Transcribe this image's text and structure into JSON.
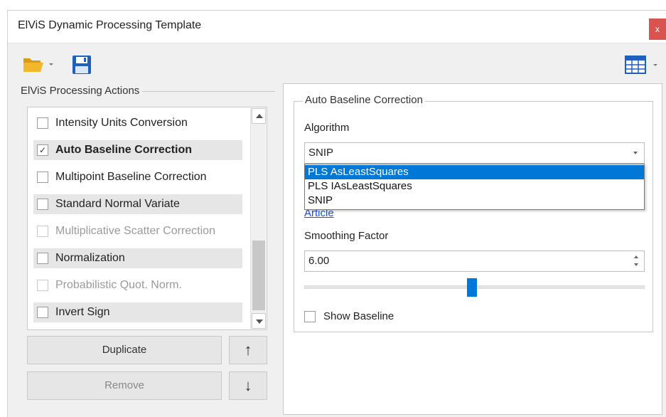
{
  "window": {
    "title": "ElViS Dynamic Processing Template",
    "close_label": "x"
  },
  "toolbar": {
    "open_icon": "folder-open-icon",
    "save_icon": "save-disk-icon",
    "layout_icon": "table-grid-icon",
    "colors": {
      "folder": "#f2b72c",
      "disk": "#1f5fbf"
    }
  },
  "actions_panel": {
    "label": "ElViS Processing Actions",
    "items": [
      {
        "label": "Intensity Units Conversion",
        "checked": false,
        "state": "normal"
      },
      {
        "label": "Auto Baseline Correction",
        "checked": true,
        "state": "selected"
      },
      {
        "label": "Multipoint Baseline Correction",
        "checked": false,
        "state": "normal"
      },
      {
        "label": "Standard Normal Variate",
        "checked": false,
        "state": "normal"
      },
      {
        "label": "Multiplicative Scatter Correction",
        "checked": false,
        "state": "disabled"
      },
      {
        "label": "Normalization",
        "checked": false,
        "state": "normal"
      },
      {
        "label": "Probabilistic Quot. Norm.",
        "checked": false,
        "state": "disabled"
      },
      {
        "label": "Invert Sign",
        "checked": false,
        "state": "normal"
      }
    ],
    "duplicate_label": "Duplicate",
    "remove_label": "Remove",
    "move_up_label": "↑",
    "move_down_label": "↓",
    "check_mark": "✓"
  },
  "settings": {
    "group_title": "Auto Baseline Correction",
    "algorithm_label": "Algorithm",
    "algorithm_value": "SNIP",
    "algorithm_options": [
      "PLS AsLeastSquares",
      "PLS IAsLeastSquares",
      "SNIP"
    ],
    "highlighted_option": "PLS AsLeastSquares",
    "article_link": "Article",
    "smoothing_label": "Smoothing Factor",
    "smoothing_value": "6.00",
    "show_baseline_label": "Show Baseline",
    "show_baseline_checked": false,
    "accent_color": "#0078d7"
  }
}
